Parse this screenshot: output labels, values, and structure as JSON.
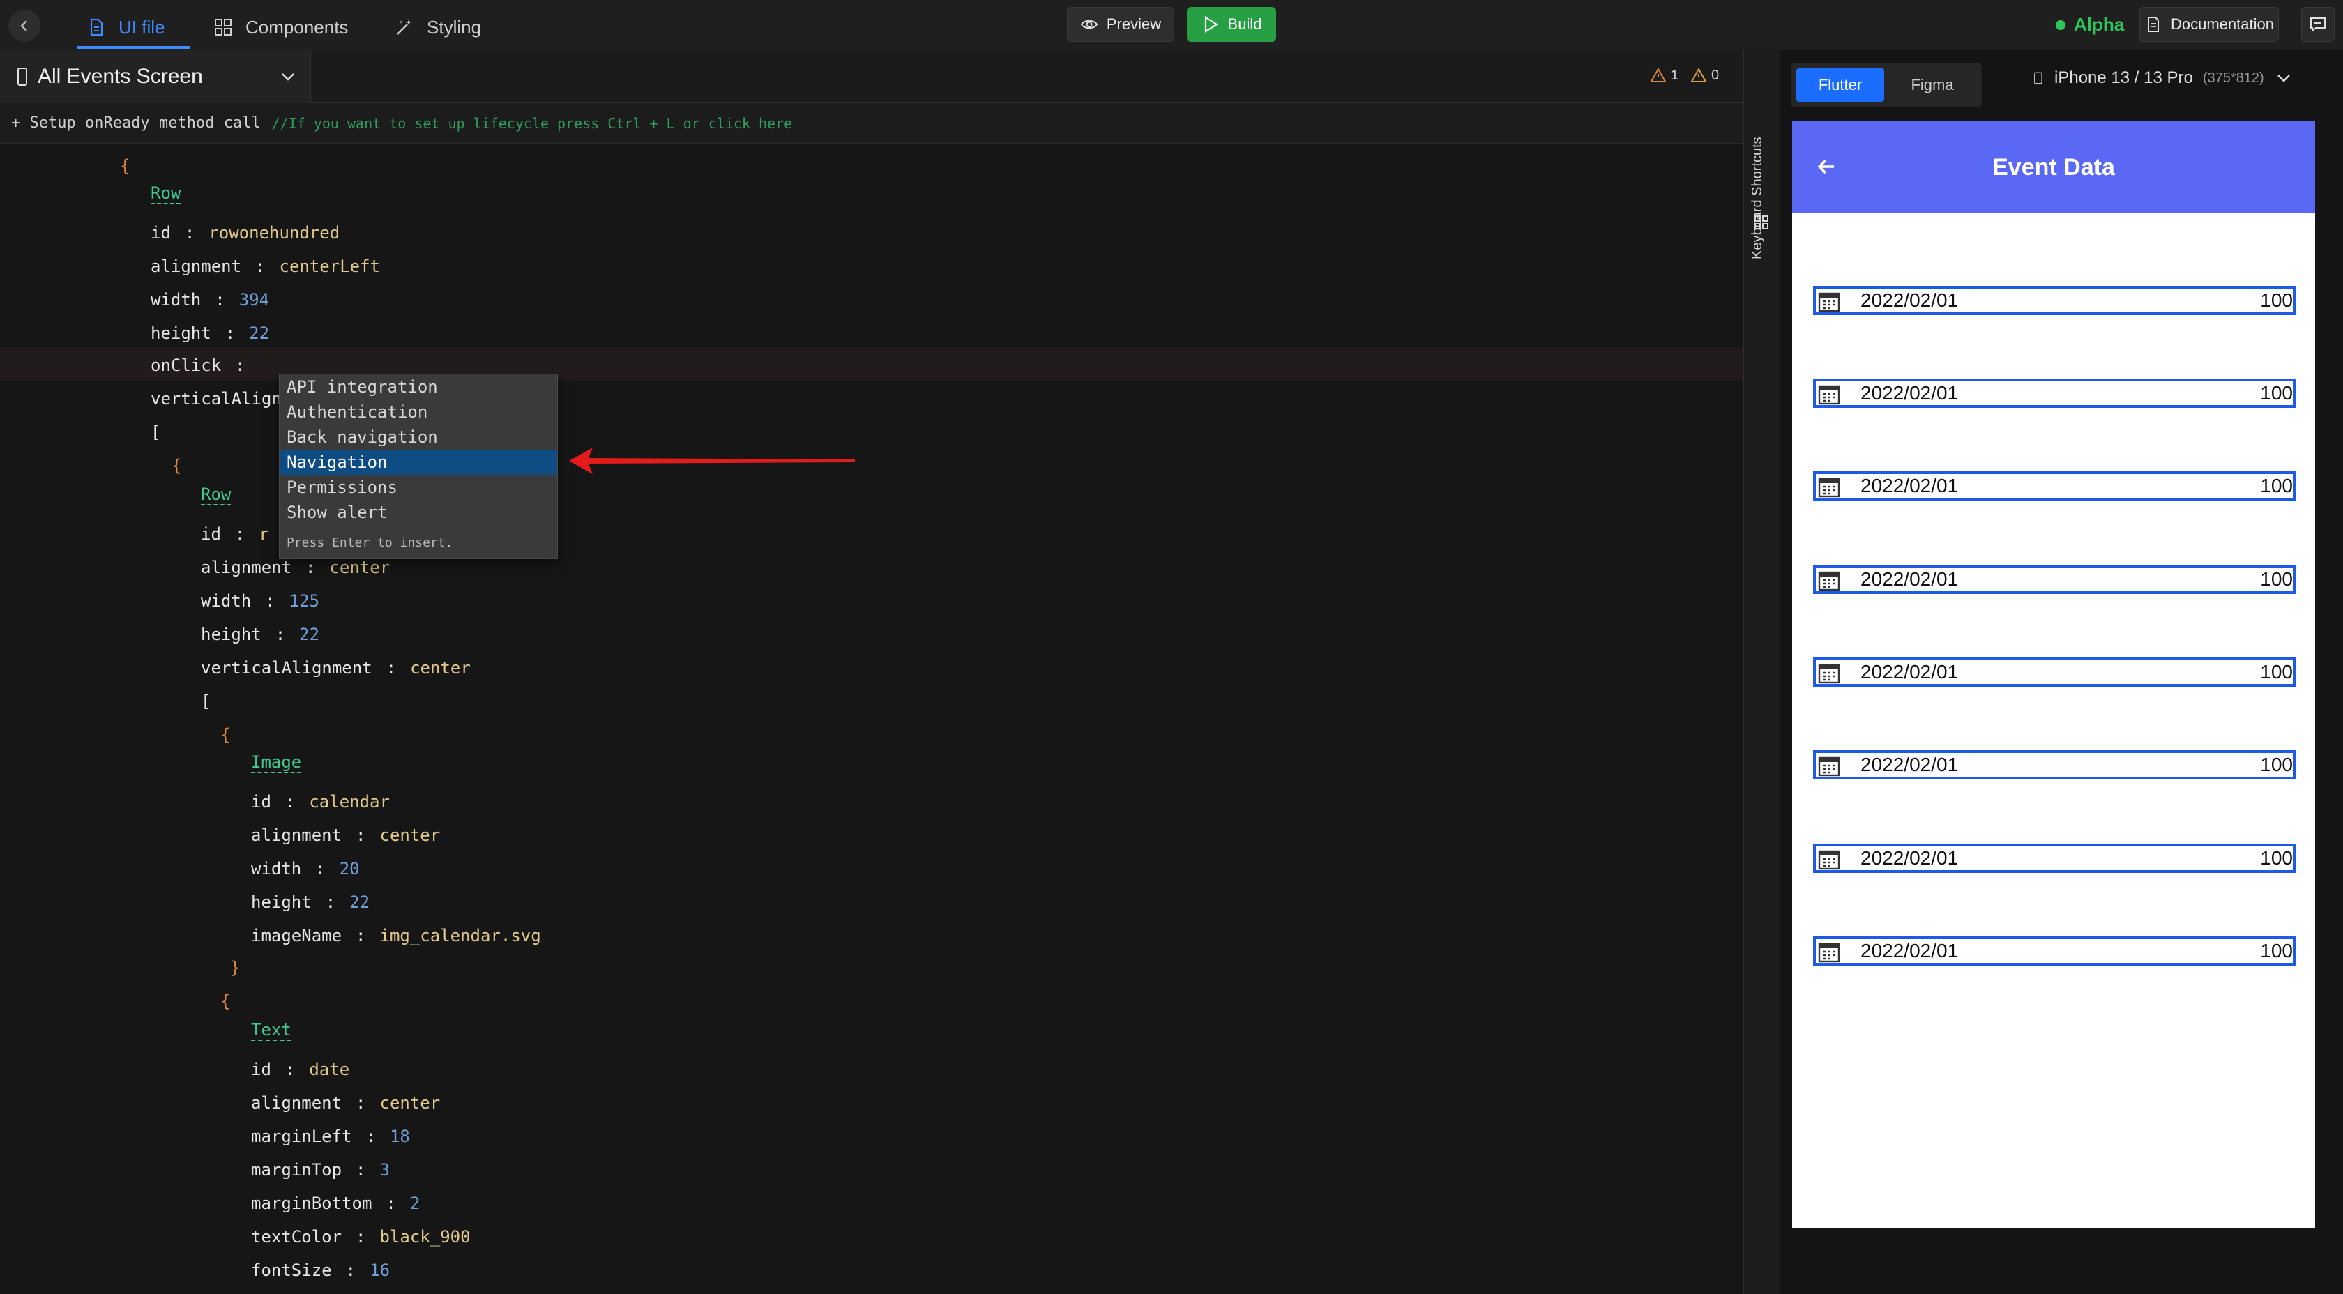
{
  "tabs": [
    {
      "label": "UI file"
    },
    {
      "label": "Components"
    },
    {
      "label": "Styling"
    }
  ],
  "toolbar": {
    "preview_label": "Preview",
    "build_label": "Build",
    "alpha_label": "Alpha",
    "documentation_label": "Documentation"
  },
  "screen": {
    "name": "All Events Screen",
    "warning_count": "1",
    "error_count": "0"
  },
  "lifecycle": {
    "text": "+ Setup onReady method call",
    "comment": "//If you want to set up lifecycle press Ctrl + L or click here"
  },
  "code": {
    "b1": "{",
    "row1_type": "Row",
    "row1_id_key": "id",
    "row1_id_val": "rowonehundred",
    "row1_align_key": "alignment",
    "row1_align_val": "centerLeft",
    "row1_width_key": "width",
    "row1_width_val": "394",
    "row1_height_key": "height",
    "row1_height_val": "22",
    "row1_onclick_key": "onClick",
    "row1_valign_key": "verticalAlign",
    "lb1": "[",
    "b2": "{",
    "row2_type": "Row",
    "row2_id_key": "id",
    "row2_id_val": "r",
    "row2_align_key": "alignment",
    "row2_align_val": "center",
    "row2_width_key": "width",
    "row2_width_val": "125",
    "row2_height_key": "height",
    "row2_height_val": "22",
    "row2_valign_key": "verticalAlignment",
    "row2_valign_val": "center",
    "lb2": "[",
    "b3": "{",
    "img_type": "Image",
    "img_id_key": "id",
    "img_id_val": "calendar",
    "img_align_key": "alignment",
    "img_align_val": "center",
    "img_width_key": "width",
    "img_width_val": "20",
    "img_height_key": "height",
    "img_height_val": "22",
    "img_name_key": "imageName",
    "img_name_val": "img_calendar.svg",
    "b3_close": "}",
    "b4": "{",
    "txt_type": "Text",
    "txt_id_key": "id",
    "txt_id_val": "date",
    "txt_align_key": "alignment",
    "txt_align_val": "center",
    "txt_ml_key": "marginLeft",
    "txt_ml_val": "18",
    "txt_mt_key": "marginTop",
    "txt_mt_val": "3",
    "txt_mb_key": "marginBottom",
    "txt_mb_val": "2",
    "txt_color_key": "textColor",
    "txt_color_val": "black_900",
    "txt_fs_key": "fontSize",
    "txt_fs_val": "16",
    "colon": ":"
  },
  "suggestions": {
    "items": [
      "API integration",
      "Authentication",
      "Back navigation",
      "Navigation",
      "Permissions",
      "Show alert"
    ],
    "selected_index": 3,
    "hint": "Press Enter to insert."
  },
  "right_panel": {
    "shortcuts_label": "Keyboard Shortcuts",
    "segment_flutter": "Flutter",
    "segment_figma": "Figma",
    "device_name": "iPhone 13 / 13 Pro",
    "device_dims": "(375*812)"
  },
  "phone": {
    "title": "Event Data",
    "events": [
      {
        "date": "2022/02/01",
        "amount": "100"
      },
      {
        "date": "2022/02/01",
        "amount": "100"
      },
      {
        "date": "2022/02/01",
        "amount": "100"
      },
      {
        "date": "2022/02/01",
        "amount": "100"
      },
      {
        "date": "2022/02/01",
        "amount": "100"
      },
      {
        "date": "2022/02/01",
        "amount": "100"
      },
      {
        "date": "2022/02/01",
        "amount": "100"
      },
      {
        "date": "2022/02/01",
        "amount": "100"
      }
    ]
  },
  "colors": {
    "accent": "#3d8bff",
    "build_green": "#27a044",
    "appbar": "#5b67f5",
    "event_border": "#1e5ae8",
    "arrow_red": "#e31b1b"
  }
}
